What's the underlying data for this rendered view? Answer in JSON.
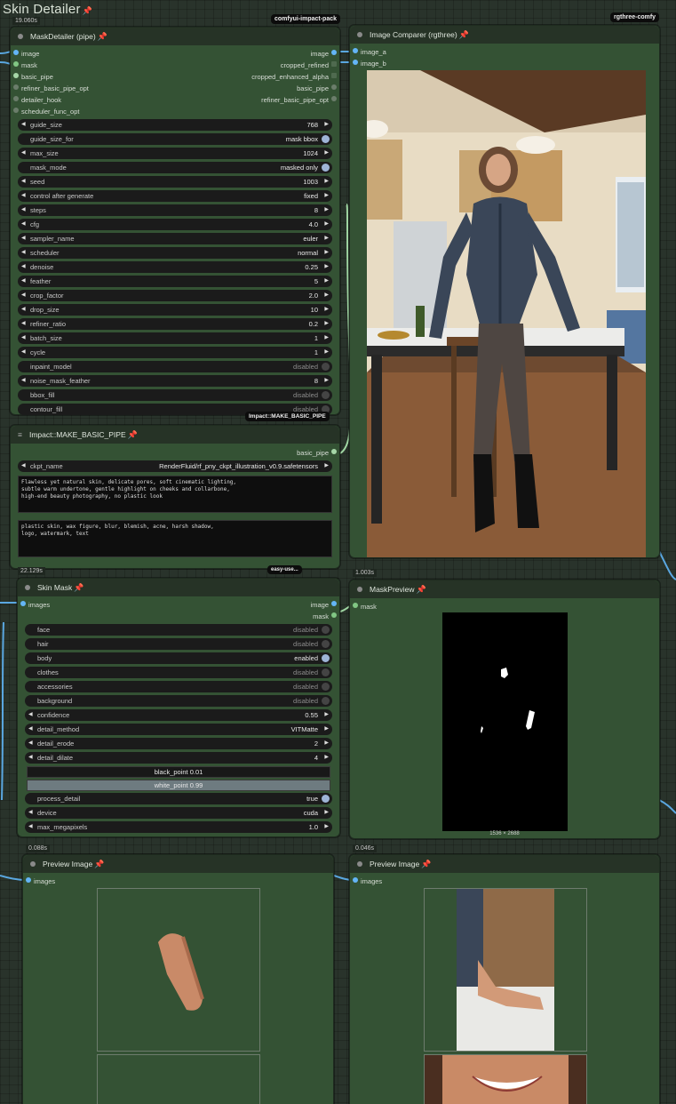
{
  "group": {
    "title": "Skin Detailer",
    "pin": "📌"
  },
  "badges": {
    "impact": "comfyui-impact-pack",
    "rgthree": "rgthree-comfy",
    "make_basic_pipe": "Impact::MAKE_BASIC_PIPE",
    "easy_use": "easy-use..."
  },
  "timers": {
    "maskdetailer": "19.060s",
    "make_basic_pipe": "22.129s",
    "image_comparer": "1.003s",
    "preview_left": "0.088s",
    "preview_right": "0.046s"
  },
  "colors": {
    "node_bg": "#345234",
    "header_bg": "#263326",
    "socket_image": "#64b5f6",
    "socket_pipe": "#a5d6a7",
    "wire": "#5aa7e0"
  },
  "maskdetailer": {
    "title": "MaskDetailer (pipe)",
    "inputs": [
      "image",
      "mask",
      "basic_pipe",
      "refiner_basic_pipe_opt",
      "detailer_hook",
      "scheduler_func_opt"
    ],
    "outputs": [
      "image",
      "cropped_refined",
      "cropped_enhanced_alpha",
      "basic_pipe",
      "refiner_basic_pipe_opt"
    ],
    "widgets": [
      {
        "name": "guide_size",
        "value": "768",
        "kind": "num"
      },
      {
        "name": "guide_size_for",
        "value": "mask bbox",
        "kind": "toggle"
      },
      {
        "name": "max_size",
        "value": "1024",
        "kind": "num"
      },
      {
        "name": "mask_mode",
        "value": "masked only",
        "kind": "toggle"
      },
      {
        "name": "seed",
        "value": "1003",
        "kind": "num"
      },
      {
        "name": "control after generate",
        "value": "fixed",
        "kind": "num"
      },
      {
        "name": "steps",
        "value": "8",
        "kind": "num"
      },
      {
        "name": "cfg",
        "value": "4.0",
        "kind": "num"
      },
      {
        "name": "sampler_name",
        "value": "euler",
        "kind": "num"
      },
      {
        "name": "scheduler",
        "value": "normal",
        "kind": "num"
      },
      {
        "name": "denoise",
        "value": "0.25",
        "kind": "num"
      },
      {
        "name": "feather",
        "value": "5",
        "kind": "num"
      },
      {
        "name": "crop_factor",
        "value": "2.0",
        "kind": "num"
      },
      {
        "name": "drop_size",
        "value": "10",
        "kind": "num"
      },
      {
        "name": "refiner_ratio",
        "value": "0.2",
        "kind": "num"
      },
      {
        "name": "batch_size",
        "value": "1",
        "kind": "num"
      },
      {
        "name": "cycle",
        "value": "1",
        "kind": "num"
      },
      {
        "name": "inpaint_model",
        "value": "disabled",
        "kind": "off"
      },
      {
        "name": "noise_mask_feather",
        "value": "8",
        "kind": "num"
      },
      {
        "name": "bbox_fill",
        "value": "disabled",
        "kind": "off"
      },
      {
        "name": "contour_fill",
        "value": "disabled",
        "kind": "off"
      }
    ]
  },
  "make_basic_pipe": {
    "title": "Impact::MAKE_BASIC_PIPE",
    "output": "basic_pipe",
    "ckpt_label": "ckpt_name",
    "ckpt_value": "RenderFluid/rf_pny_ckpt_illustration_v0.9.safetensors",
    "positive": "Flawless yet natural skin, delicate pores, soft cinematic lighting,\nsubtle warm undertone, gentle highlight on cheeks and collarbone,\nhigh-end beauty photography, no plastic look",
    "negative": "plastic skin, wax figure, blur, blemish, acne, harsh shadow,\nlogo, watermark, text"
  },
  "image_comparer": {
    "title": "Image Comparer (rgthree)",
    "inputs": [
      "image_a",
      "image_b"
    ]
  },
  "skin_mask": {
    "title": "Skin Mask",
    "input": "images",
    "outputs": [
      "image",
      "mask"
    ],
    "widgets": [
      {
        "name": "face",
        "value": "disabled",
        "kind": "off"
      },
      {
        "name": "hair",
        "value": "disabled",
        "kind": "off"
      },
      {
        "name": "body",
        "value": "enabled",
        "kind": "on"
      },
      {
        "name": "clothes",
        "value": "disabled",
        "kind": "off"
      },
      {
        "name": "accessories",
        "value": "disabled",
        "kind": "off"
      },
      {
        "name": "background",
        "value": "disabled",
        "kind": "off"
      },
      {
        "name": "confidence",
        "value": "0.55",
        "kind": "num"
      },
      {
        "name": "detail_method",
        "value": "VITMatte",
        "kind": "num"
      },
      {
        "name": "detail_erode",
        "value": "2",
        "kind": "num"
      },
      {
        "name": "detail_dilate",
        "value": "4",
        "kind": "num"
      }
    ],
    "black_point": "black_point  0.01",
    "white_point": "white_point  0.99",
    "widgets2": [
      {
        "name": "process_detail",
        "value": "true",
        "kind": "on"
      },
      {
        "name": "device",
        "value": "cuda",
        "kind": "num"
      },
      {
        "name": "max_megapixels",
        "value": "1.0",
        "kind": "num"
      }
    ]
  },
  "mask_preview": {
    "title": "MaskPreview",
    "input": "mask",
    "dims": "1536 × 2688"
  },
  "preview_left": {
    "title": "Preview Image",
    "input": "images"
  },
  "preview_right": {
    "title": "Preview Image",
    "input": "images"
  }
}
